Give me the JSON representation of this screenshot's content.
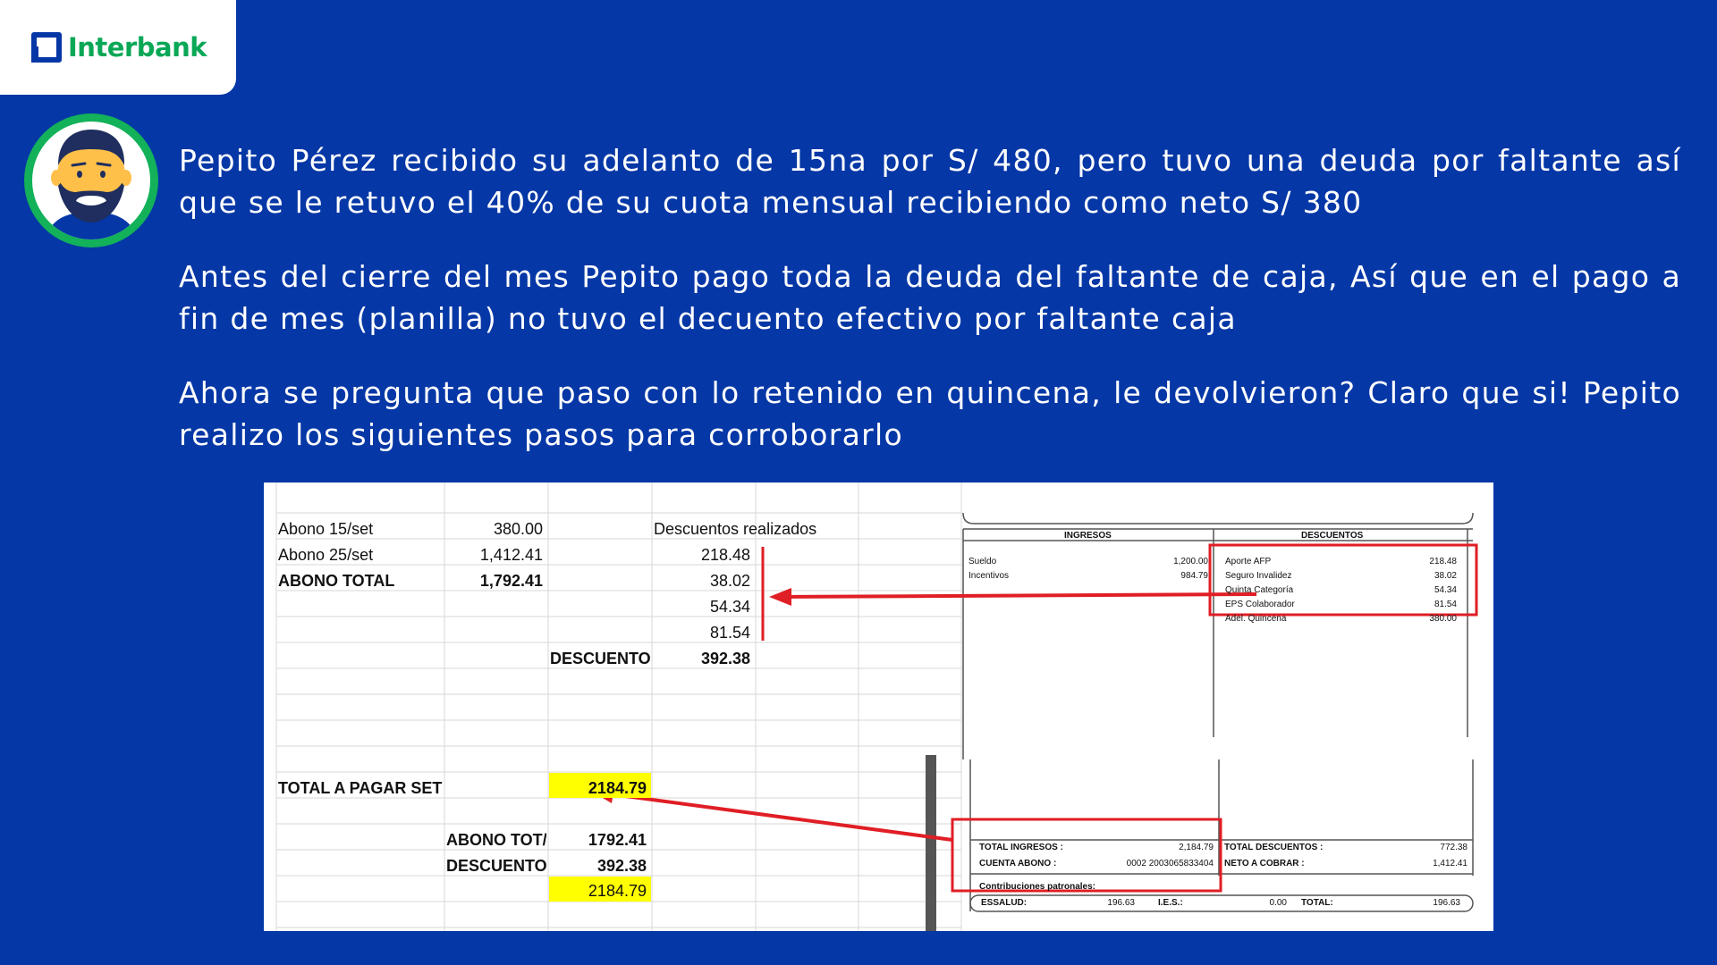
{
  "brand": {
    "name": "Interbank",
    "color": "#0aa756",
    "background": "#0537a6"
  },
  "paragraphs": [
    "Pepito Pérez recibido su adelanto de 15na por S/ 480, pero tuvo una deuda por faltante así que se le retuvo el 40% de su cuota mensual recibiendo como neto S/ 380",
    "Antes del cierre del mes Pepito pago toda la deuda del faltante de caja, Así que en el  pago a fin de mes (planilla) no tuvo el decuento efectivo por faltante caja",
    "Ahora se pregunta que paso con lo retenido en quincena, le devolvieron? Claro que si! Pepito realizo los siguientes pasos para corroborarlo"
  ],
  "spreadsheet": {
    "abonos": [
      {
        "label": "Abono 15/set",
        "value": "380.00"
      },
      {
        "label": "Abono 25/set",
        "value": "1,412.41"
      },
      {
        "label": "ABONO TOTAL",
        "value": "1,792.41"
      }
    ],
    "descuentos_header": "Descuentos realizados",
    "descuentos": [
      "218.48",
      "38.02",
      "54.34",
      "81.54"
    ],
    "descuento_label": "DESCUENTO",
    "descuento_total": "392.38",
    "total_pagar_label": "TOTAL A PAGAR SET",
    "total_pagar_value": "2184.79",
    "check_rows": [
      {
        "label": "ABONO TOT/",
        "value": "1792.41"
      },
      {
        "label": "DESCUENTO",
        "value": "392.38"
      }
    ],
    "check_total": "2184.79"
  },
  "payslip": {
    "ingresos_header": "INGRESOS",
    "descuentos_header": "DESCUENTOS",
    "ingresos": [
      {
        "label": "Sueldo",
        "value": "1,200.00"
      },
      {
        "label": "Incentivos",
        "value": "984.79"
      }
    ],
    "descuentos": [
      {
        "label": "Aporte AFP",
        "value": "218.48"
      },
      {
        "label": "Seguro Invalidez",
        "value": "38.02"
      },
      {
        "label": "Quinta Categoría",
        "value": "54.34"
      },
      {
        "label": "EPS Colaborador",
        "value": "81.54"
      },
      {
        "label": "Adel. Quincena",
        "value": "380.00"
      }
    ],
    "total_ingresos_label": "TOTAL INGRESOS :",
    "total_ingresos_value": "2,184.79",
    "cuenta_abono_label": "CUENTA ABONO    :",
    "cuenta_abono_value": "0002 2003065833404",
    "total_descuentos_label": "TOTAL DESCUENTOS :",
    "total_descuentos_value": "772.38",
    "neto_label": "NETO A COBRAR      :",
    "neto_value": "1,412.41",
    "contrib_label": "Contribuciones patronales:",
    "essalud_label": "ESSALUD:",
    "essalud_value": "196.63",
    "ies_label": "I.E.S.:",
    "ies_value": "0.00",
    "total_label": "TOTAL:",
    "total_value": "196.63"
  }
}
